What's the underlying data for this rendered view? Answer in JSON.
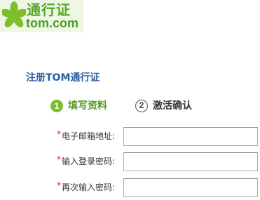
{
  "logo": {
    "name_cn": "通行证",
    "domain": "tom.com",
    "mark_color": "#7cbf2a",
    "background": "#eef6e4"
  },
  "section": {
    "title": "注册TOM通行证"
  },
  "steps": [
    {
      "number": "1",
      "label": "填写资料",
      "state": "active",
      "color": "#7cbf2a"
    },
    {
      "number": "2",
      "label": "激活确认",
      "state": "inactive",
      "color": "#555555"
    }
  ],
  "form": {
    "required_marker": "*",
    "fields": [
      {
        "label": "电子邮箱地址:",
        "value": "",
        "type": "text"
      },
      {
        "label": "输入登录密码:",
        "value": "",
        "type": "password"
      },
      {
        "label": "再次输入密码:",
        "value": "",
        "type": "password"
      }
    ]
  },
  "colors": {
    "title_blue": "#2f5da1",
    "required_red": "#e0201a",
    "brand_green": "#58a62a"
  }
}
